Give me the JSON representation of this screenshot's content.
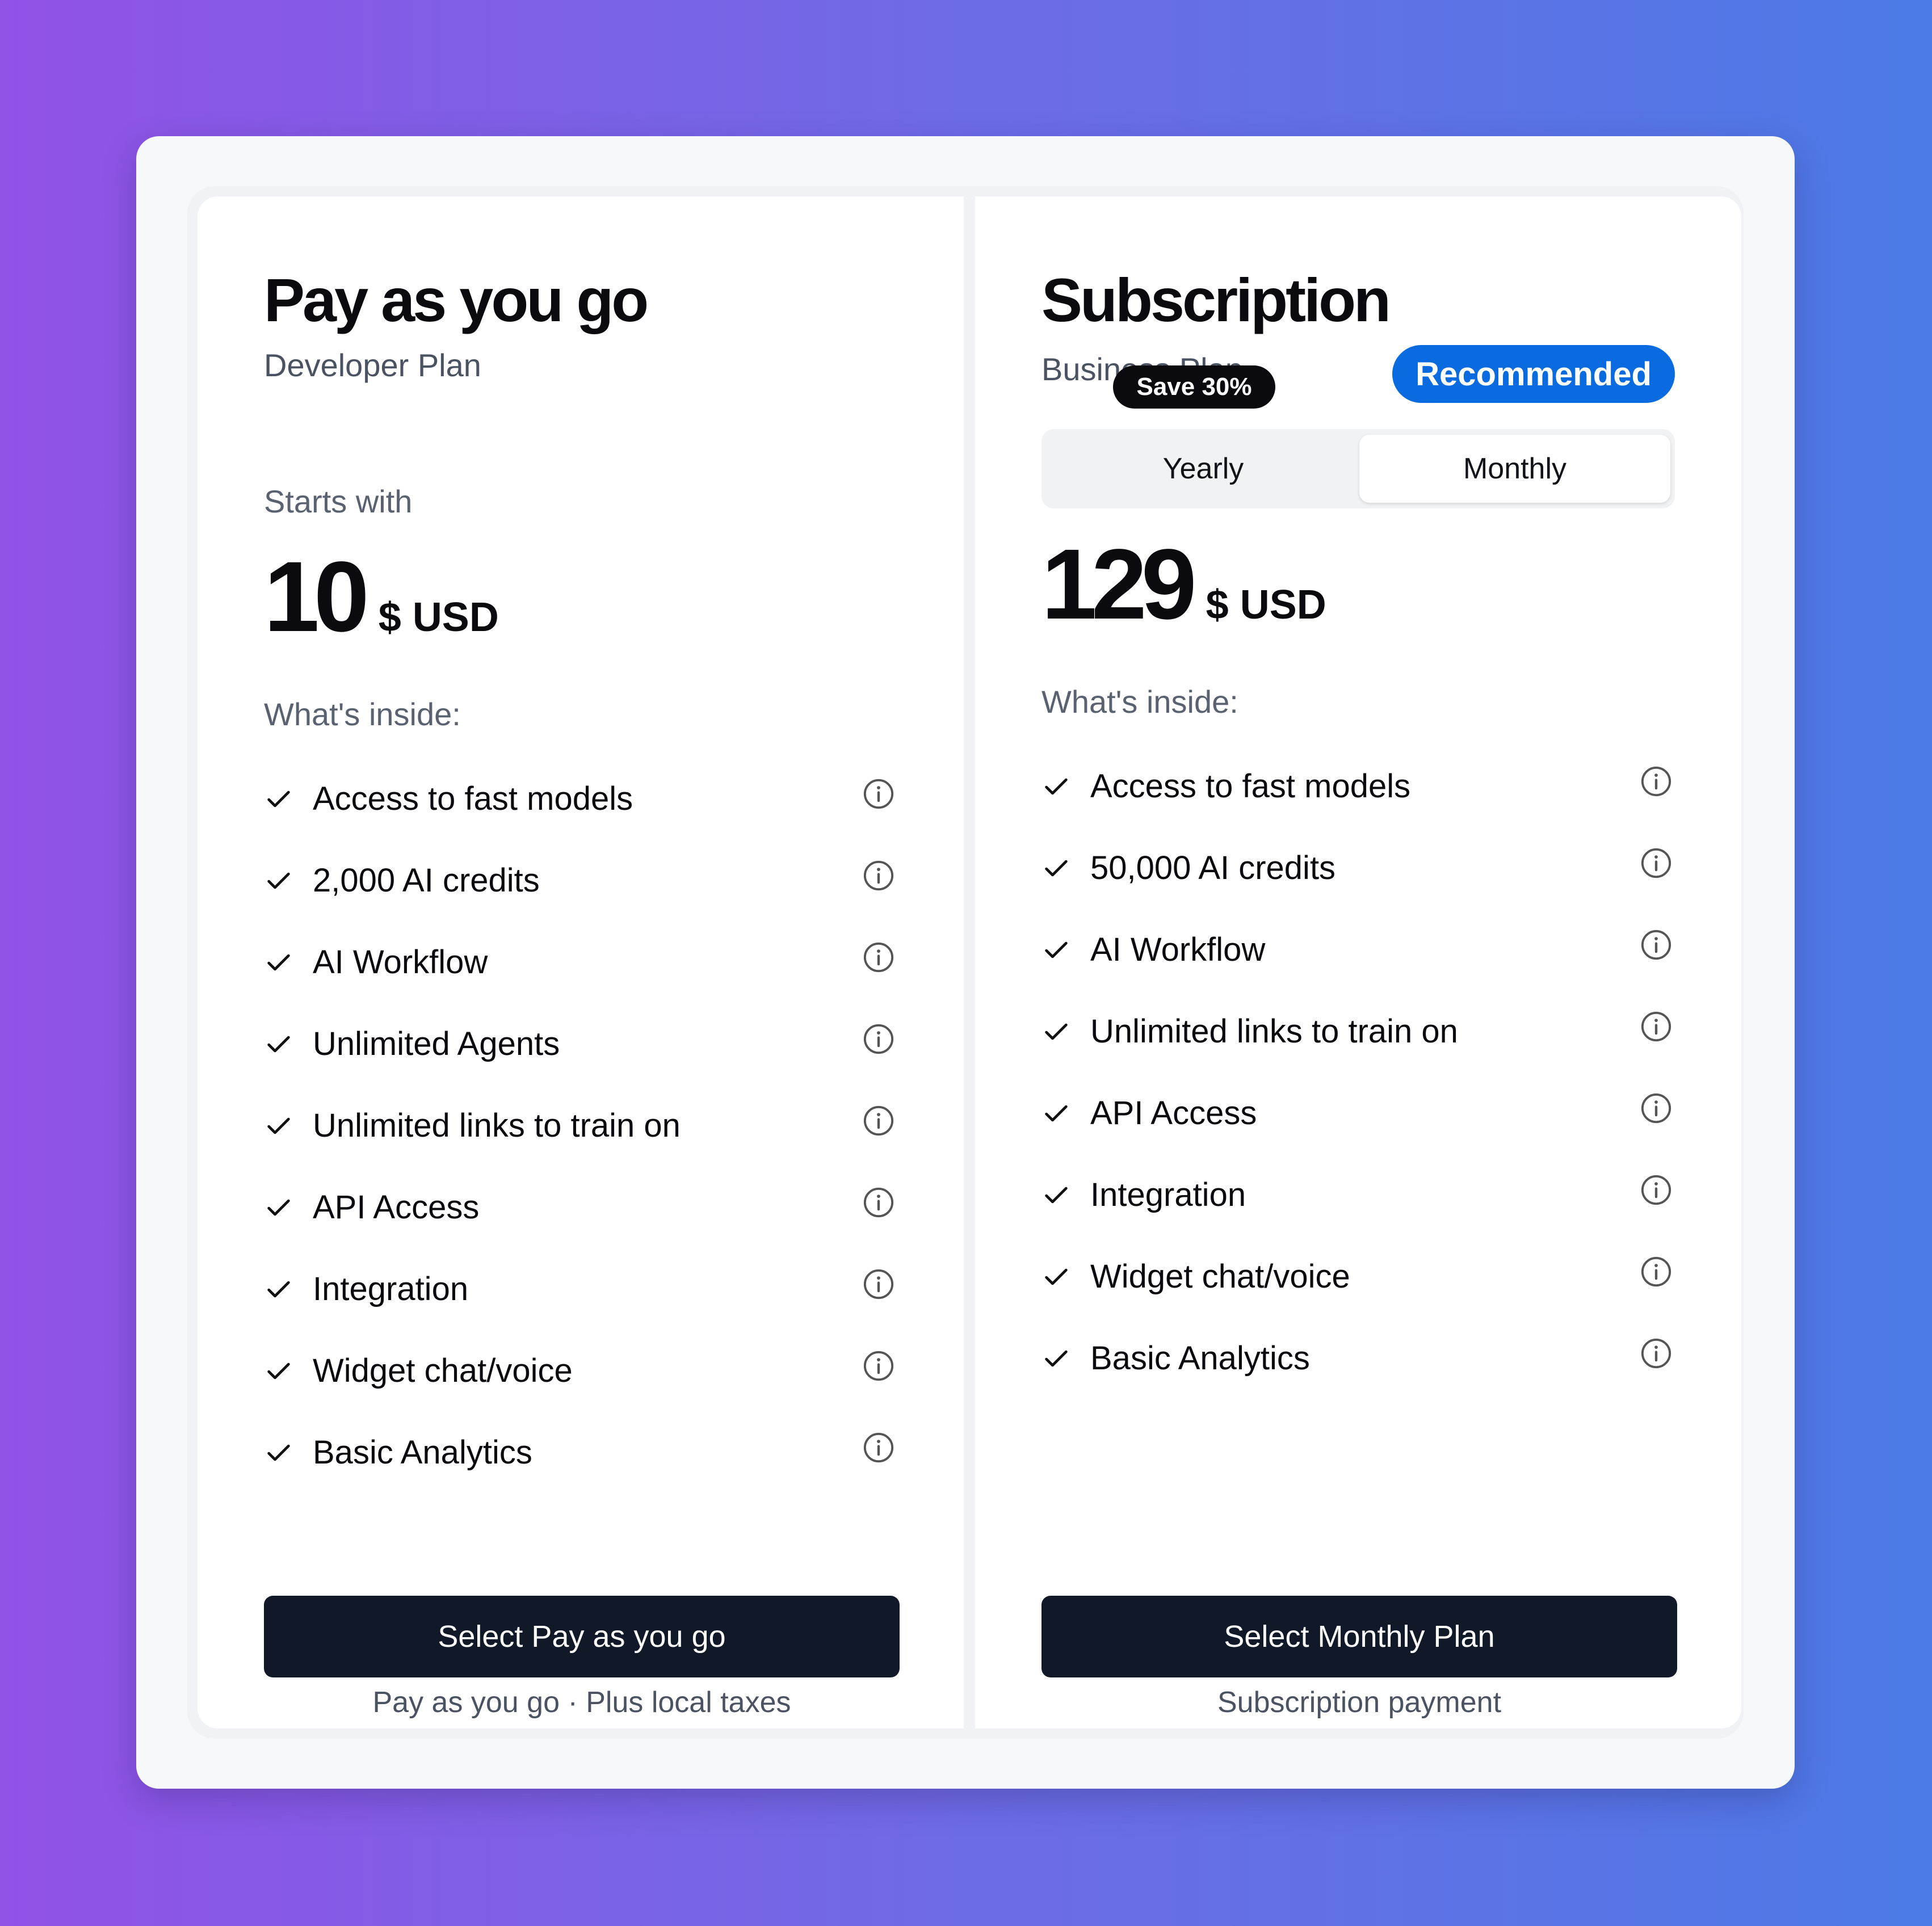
{
  "plans": {
    "payg": {
      "title": "Pay as you go",
      "subtitle": "Developer Plan",
      "starts_with": "Starts with",
      "price": "10",
      "currency": "$ USD",
      "inside_label": "What's inside:",
      "features": [
        "Access to fast models",
        "2,000 AI credits",
        "AI Workflow",
        "Unlimited Agents",
        "Unlimited links to train on",
        "API Access",
        "Integration",
        "Widget chat/voice",
        "Basic Analytics"
      ],
      "cta": "Select Pay as you go",
      "note": "Pay as you go · Plus local taxes"
    },
    "subscription": {
      "title": "Subscription",
      "subtitle": "Business Plan",
      "badge": "Recommended",
      "toggle": {
        "yearly": "Yearly",
        "monthly": "Monthly",
        "selected": "Monthly",
        "save_badge": "Save 30%"
      },
      "price": "129",
      "currency": "$ USD",
      "inside_label": "What's inside:",
      "features": [
        "Access to fast models",
        "50,000 AI credits",
        "AI Workflow",
        "Unlimited links to train on",
        "API Access",
        "Integration",
        "Widget chat/voice",
        "Basic Analytics"
      ],
      "cta": "Select Monthly Plan",
      "note": "Subscription payment"
    }
  },
  "icons": {
    "feature_check": "check-icon",
    "feature_info": "info-icon"
  },
  "colors": {
    "badge": "#0A6BE0",
    "cta": "#111827",
    "background_start": "#9152E6",
    "background_end": "#4C7AE6"
  }
}
